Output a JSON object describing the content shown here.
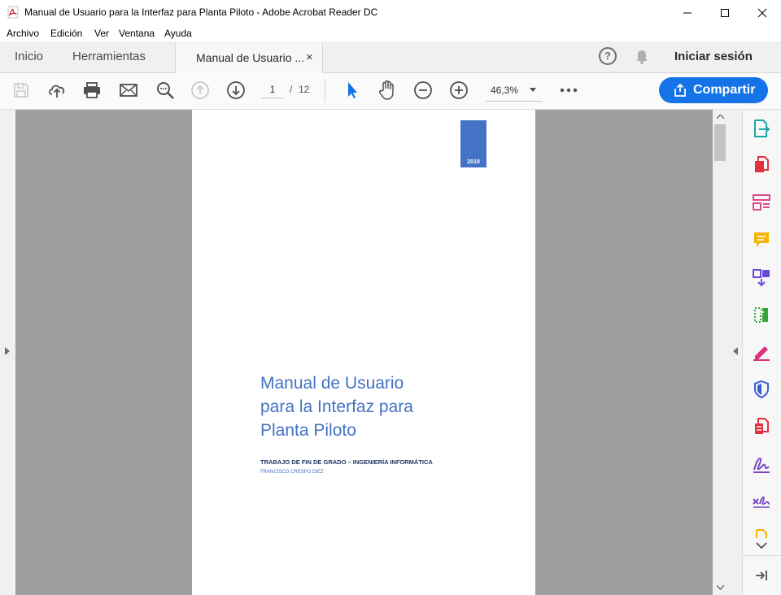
{
  "window": {
    "title": "Manual de Usuario para la Interfaz para Planta Piloto - Adobe Acrobat Reader DC"
  },
  "menubar": {
    "items": [
      "Archivo",
      "Edición",
      "Ver",
      "Ventana",
      "Ayuda"
    ]
  },
  "tabs": {
    "home": "Inicio",
    "tools": "Herramientas",
    "document": "Manual de Usuario ...",
    "close_symbol": "×",
    "help_symbol": "?",
    "signin": "Iniciar sesión"
  },
  "toolbar": {
    "page_current": "1",
    "page_separator": "/",
    "page_total": "12",
    "zoom": "46,3%",
    "share_label": "Compartir"
  },
  "document": {
    "year": "2019",
    "title_lines": [
      "Manual de Usuario",
      "para la Interfaz para",
      "Planta Piloto"
    ],
    "subtitle": "TRABAJO DE FIN DE GRADO – INGENIERÍA INFORMÁTICA",
    "author": "FRANCISCO CRESPO DIEZ"
  },
  "colors": {
    "accent": "#1473e6",
    "doc_blue": "#4472c4",
    "doc_navy": "#1f3864"
  }
}
